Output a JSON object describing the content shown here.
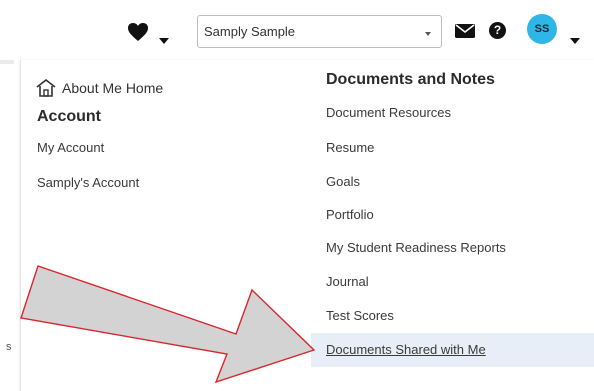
{
  "header": {
    "user_select": {
      "value": "Samply Sample"
    },
    "avatar_initials": "SS"
  },
  "left_menu": {
    "home_label": "About Me Home",
    "heading": "Account",
    "items": [
      {
        "label": "My Account"
      },
      {
        "label": "Samply's Account"
      }
    ]
  },
  "right_menu": {
    "heading": "Documents and Notes",
    "items": [
      {
        "label": "Document Resources"
      },
      {
        "label": "Resume"
      },
      {
        "label": "Goals"
      },
      {
        "label": "Portfolio"
      },
      {
        "label": "My Student Readiness Reports"
      },
      {
        "label": "Journal"
      },
      {
        "label": "Test Scores"
      },
      {
        "label": "Documents Shared with Me",
        "highlighted": true
      }
    ]
  },
  "background_page": {
    "partial_char": "s"
  },
  "annotation": {
    "arrow_fill": "#d3d3d3",
    "arrow_stroke": "#d9262c"
  },
  "colors": {
    "avatar": "#2fb6e9",
    "highlight": "#e8eef8"
  }
}
